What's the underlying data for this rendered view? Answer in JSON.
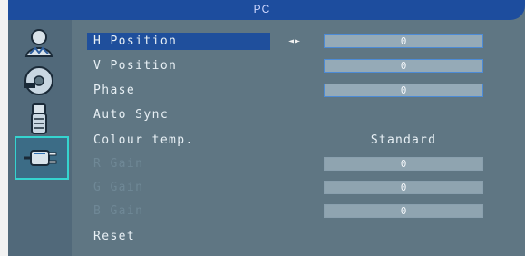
{
  "osd": {
    "title": "PC",
    "sidebar": [
      {
        "name": "person-icon",
        "selected": false
      },
      {
        "name": "disc-icon",
        "selected": false
      },
      {
        "name": "settings-icon",
        "selected": false
      },
      {
        "name": "plug-icon",
        "selected": true
      }
    ],
    "rows": [
      {
        "label": "H Position",
        "value": "0",
        "type": "slider",
        "selected": true,
        "arrows": "◄►"
      },
      {
        "label": "V Position",
        "value": "0",
        "type": "slider"
      },
      {
        "label": "Phase",
        "value": "0",
        "type": "slider"
      },
      {
        "label": "Auto Sync",
        "type": "action"
      },
      {
        "label": "Colour temp.",
        "value": "Standard",
        "type": "text"
      },
      {
        "label": "R Gain",
        "value": "0",
        "type": "slider",
        "disabled": true
      },
      {
        "label": "G Gain",
        "value": "0",
        "type": "slider",
        "disabled": true
      },
      {
        "label": "B Gain",
        "value": "0",
        "type": "slider",
        "disabled": true
      },
      {
        "label": "Reset",
        "type": "action"
      }
    ]
  }
}
